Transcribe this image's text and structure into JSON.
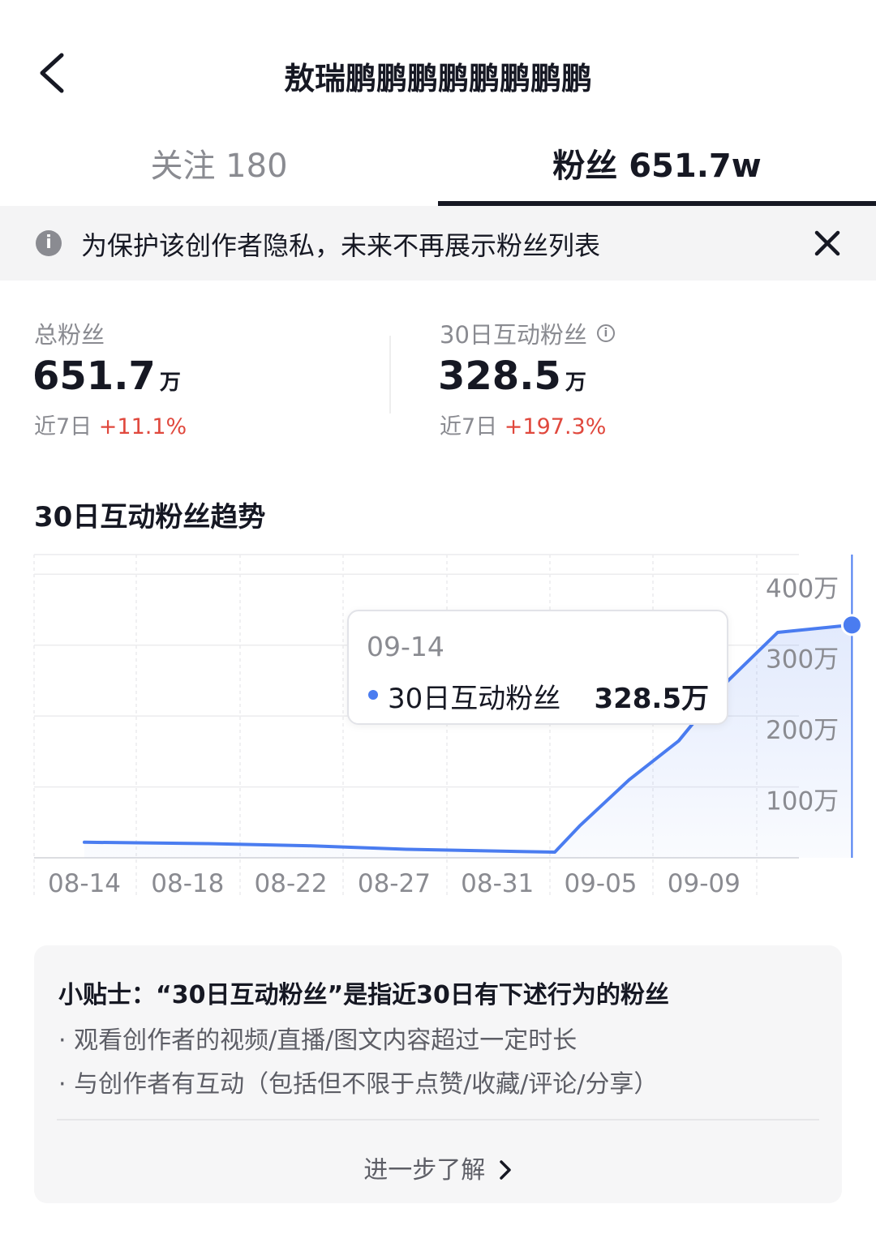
{
  "header": {
    "title": "敖瑞鹏鹏鹏鹏鹏鹏鹏鹏"
  },
  "tabs": {
    "follow": "关注 180",
    "fans": "粉丝 651.7w"
  },
  "notice": {
    "text": "为保护该创作者隐私，未来不再展示粉丝列表"
  },
  "stats": {
    "total": {
      "label": "总粉丝",
      "value": "651.7",
      "unit": "万",
      "period": "近7日",
      "change": "+11.1%"
    },
    "active": {
      "label": "30日互动粉丝",
      "value": "328.5",
      "unit": "万",
      "period": "近7日",
      "change": "+197.3%"
    }
  },
  "trend": {
    "title": "30日互动粉丝趋势"
  },
  "chart_data": {
    "type": "line",
    "x_ticks": [
      "08-14",
      "08-18",
      "08-22",
      "08-27",
      "08-31",
      "09-05",
      "09-09"
    ],
    "y_ticks": [
      "100万",
      "200万",
      "300万",
      "400万"
    ],
    "ylim": [
      0,
      400
    ],
    "points": [
      [
        "08-14",
        22
      ],
      [
        "08-19",
        20
      ],
      [
        "08-23",
        17
      ],
      [
        "08-27",
        12
      ],
      [
        "09-02",
        8
      ],
      [
        "09-03",
        45
      ],
      [
        "09-05",
        110
      ],
      [
        "09-07",
        165
      ],
      [
        "09-09",
        250
      ],
      [
        "09-11",
        318
      ],
      [
        "09-14",
        328.5
      ]
    ],
    "series": [
      {
        "name": "30日互动粉丝",
        "color": "#4a7cf0"
      }
    ],
    "grid": true,
    "tooltip": {
      "date": "09-14",
      "series": "30日互动粉丝",
      "value": "328.5万"
    }
  },
  "tips": {
    "title": "小贴士：“30日互动粉丝”是指近30日有下述行为的粉丝",
    "items": [
      "· 观看创作者的视频/直播/图文内容超过一定时长",
      "· 与创作者有互动（包括但不限于点赞/收藏/评论/分享）"
    ],
    "link": "进一步了解"
  }
}
